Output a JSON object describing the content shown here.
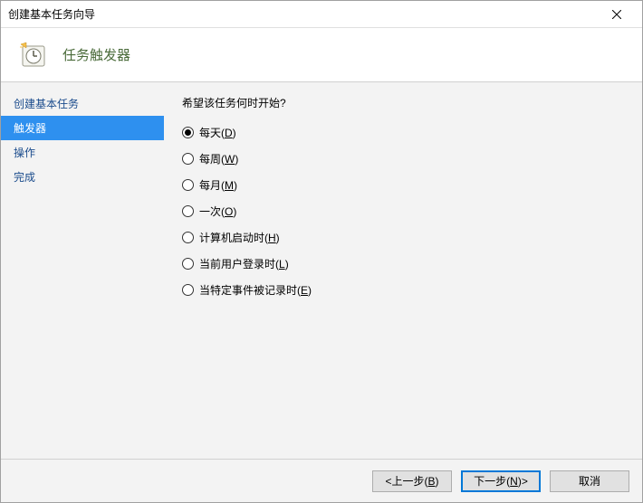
{
  "window": {
    "title": "创建基本任务向导"
  },
  "header": {
    "title": "任务触发器"
  },
  "sidebar": {
    "items": [
      {
        "label": "创建基本任务",
        "selected": false
      },
      {
        "label": "触发器",
        "selected": true
      },
      {
        "label": "操作",
        "selected": false
      },
      {
        "label": "完成",
        "selected": false
      }
    ]
  },
  "content": {
    "question": "希望该任务何时开始?",
    "options": [
      {
        "text": "每天",
        "accel": "D",
        "checked": true
      },
      {
        "text": "每周",
        "accel": "W",
        "checked": false
      },
      {
        "text": "每月",
        "accel": "M",
        "checked": false
      },
      {
        "text": "一次",
        "accel": "O",
        "checked": false
      },
      {
        "text": "计算机启动时",
        "accel": "H",
        "checked": false
      },
      {
        "text": "当前用户登录时",
        "accel": "L",
        "checked": false
      },
      {
        "text": "当特定事件被记录时",
        "accel": "E",
        "checked": false
      }
    ]
  },
  "footer": {
    "back_prefix": "< ",
    "back_text": "上一步",
    "back_accel": "B",
    "next_text": "下一步",
    "next_accel": "N",
    "next_suffix": " >",
    "cancel": "取消"
  }
}
